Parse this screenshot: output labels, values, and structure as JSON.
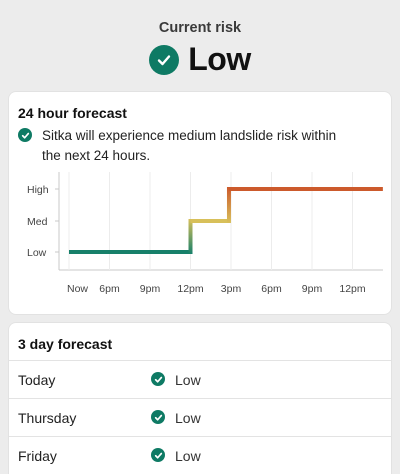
{
  "header": {
    "label": "Current risk",
    "status": "Low",
    "status_icon": "check-circle-icon",
    "accent_color": "#0e7a64"
  },
  "forecast_24h": {
    "title": "24 hour forecast",
    "note_icon": "check-circle-icon",
    "note": "Sitka will experience medium landslide risk within the next 24 hours."
  },
  "chart_data": {
    "type": "line",
    "step": true,
    "grid": "vertical",
    "y_categories": [
      "Low",
      "Med",
      "High"
    ],
    "x_ticks": [
      "Now",
      "6pm",
      "9pm",
      "12pm",
      "3pm",
      "6pm",
      "9pm",
      "12pm"
    ],
    "series": [
      {
        "points": [
          {
            "x": 0,
            "y": 0
          },
          {
            "x": 3.0,
            "y": 0
          },
          {
            "x": 3.0,
            "y": 1
          },
          {
            "x": 3.95,
            "y": 1
          },
          {
            "x": 3.95,
            "y": 2
          },
          {
            "x": 7.75,
            "y": 2
          }
        ],
        "colors": {
          "Low": "#17806a",
          "Med": "#d8c05a",
          "High": "#cc5a2c"
        }
      }
    ]
  },
  "forecast_3day": {
    "title": "3 day forecast",
    "rows": [
      {
        "day": "Today",
        "risk": "Low"
      },
      {
        "day": "Thursday",
        "risk": "Low"
      },
      {
        "day": "Friday",
        "risk": "Low"
      }
    ]
  }
}
